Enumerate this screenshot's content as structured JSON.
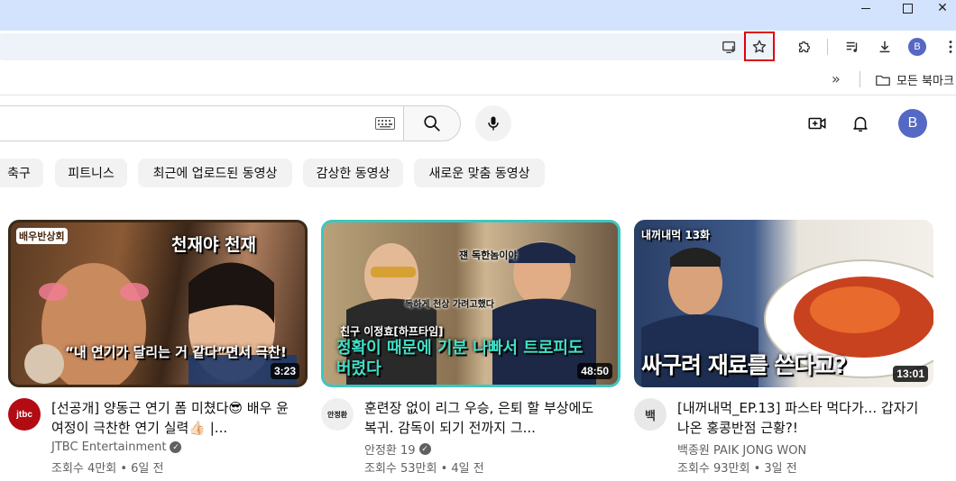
{
  "browser": {
    "window_close": "✕",
    "bookmarks_overflow": "»",
    "bookmarks_folder": "모든 북마크",
    "profile_initial": "B"
  },
  "youtube": {
    "avatar_initial": "B",
    "chips": [
      "축구",
      "피트니스",
      "최근에 업로드된 동영상",
      "감상한 동영상",
      "새로운 맞춤 동영상"
    ],
    "videos": [
      {
        "thumb_caption_top": "천재야 천재",
        "thumb_caption_bottom": "“내 연기가 달리는 거 같다”면서 극찬!",
        "thumb_badge": "배우반상회",
        "duration": "3:23",
        "title": "[선공개] 양동근 연기 폼 미쳤다😎 배우 윤여정이 극찬한 연기 실력👍🏻 |...",
        "channel": "JTBC Entertainment",
        "stats": "조회수 4만회 • 6일 전",
        "avatar_text": "jtbc"
      },
      {
        "thumb_caption_top": "친구 이정효[하프타임]",
        "thumb_caption_bottom": "정확이 때문에 기분 나빠서 트로피도 버렸다",
        "thumb_note1": "쟨 독한놈이야",
        "thumb_note2": "독하게 천상 가려고했다",
        "duration": "48:50",
        "title": "훈련장 없이 리그 우승, 은퇴 할 부상에도 복귀. 감독이 되기 전까지 그...",
        "channel": "안정환 19",
        "stats": "조회수 53만회 • 4일 전",
        "avatar_text": "안정환"
      },
      {
        "thumb_caption_top": "내꺼내먹 13화",
        "thumb_caption_bottom": "싸구려 재료를 쓴다고?",
        "duration": "13:01",
        "title": "[내꺼내먹_EP.13] 파스타 먹다가... 갑자기 나온 홍콩반점 근황?!",
        "channel": "백종원 PAIK JONG WON",
        "stats": "조회수 93만회 • 3일 전",
        "avatar_text": "백"
      }
    ]
  }
}
